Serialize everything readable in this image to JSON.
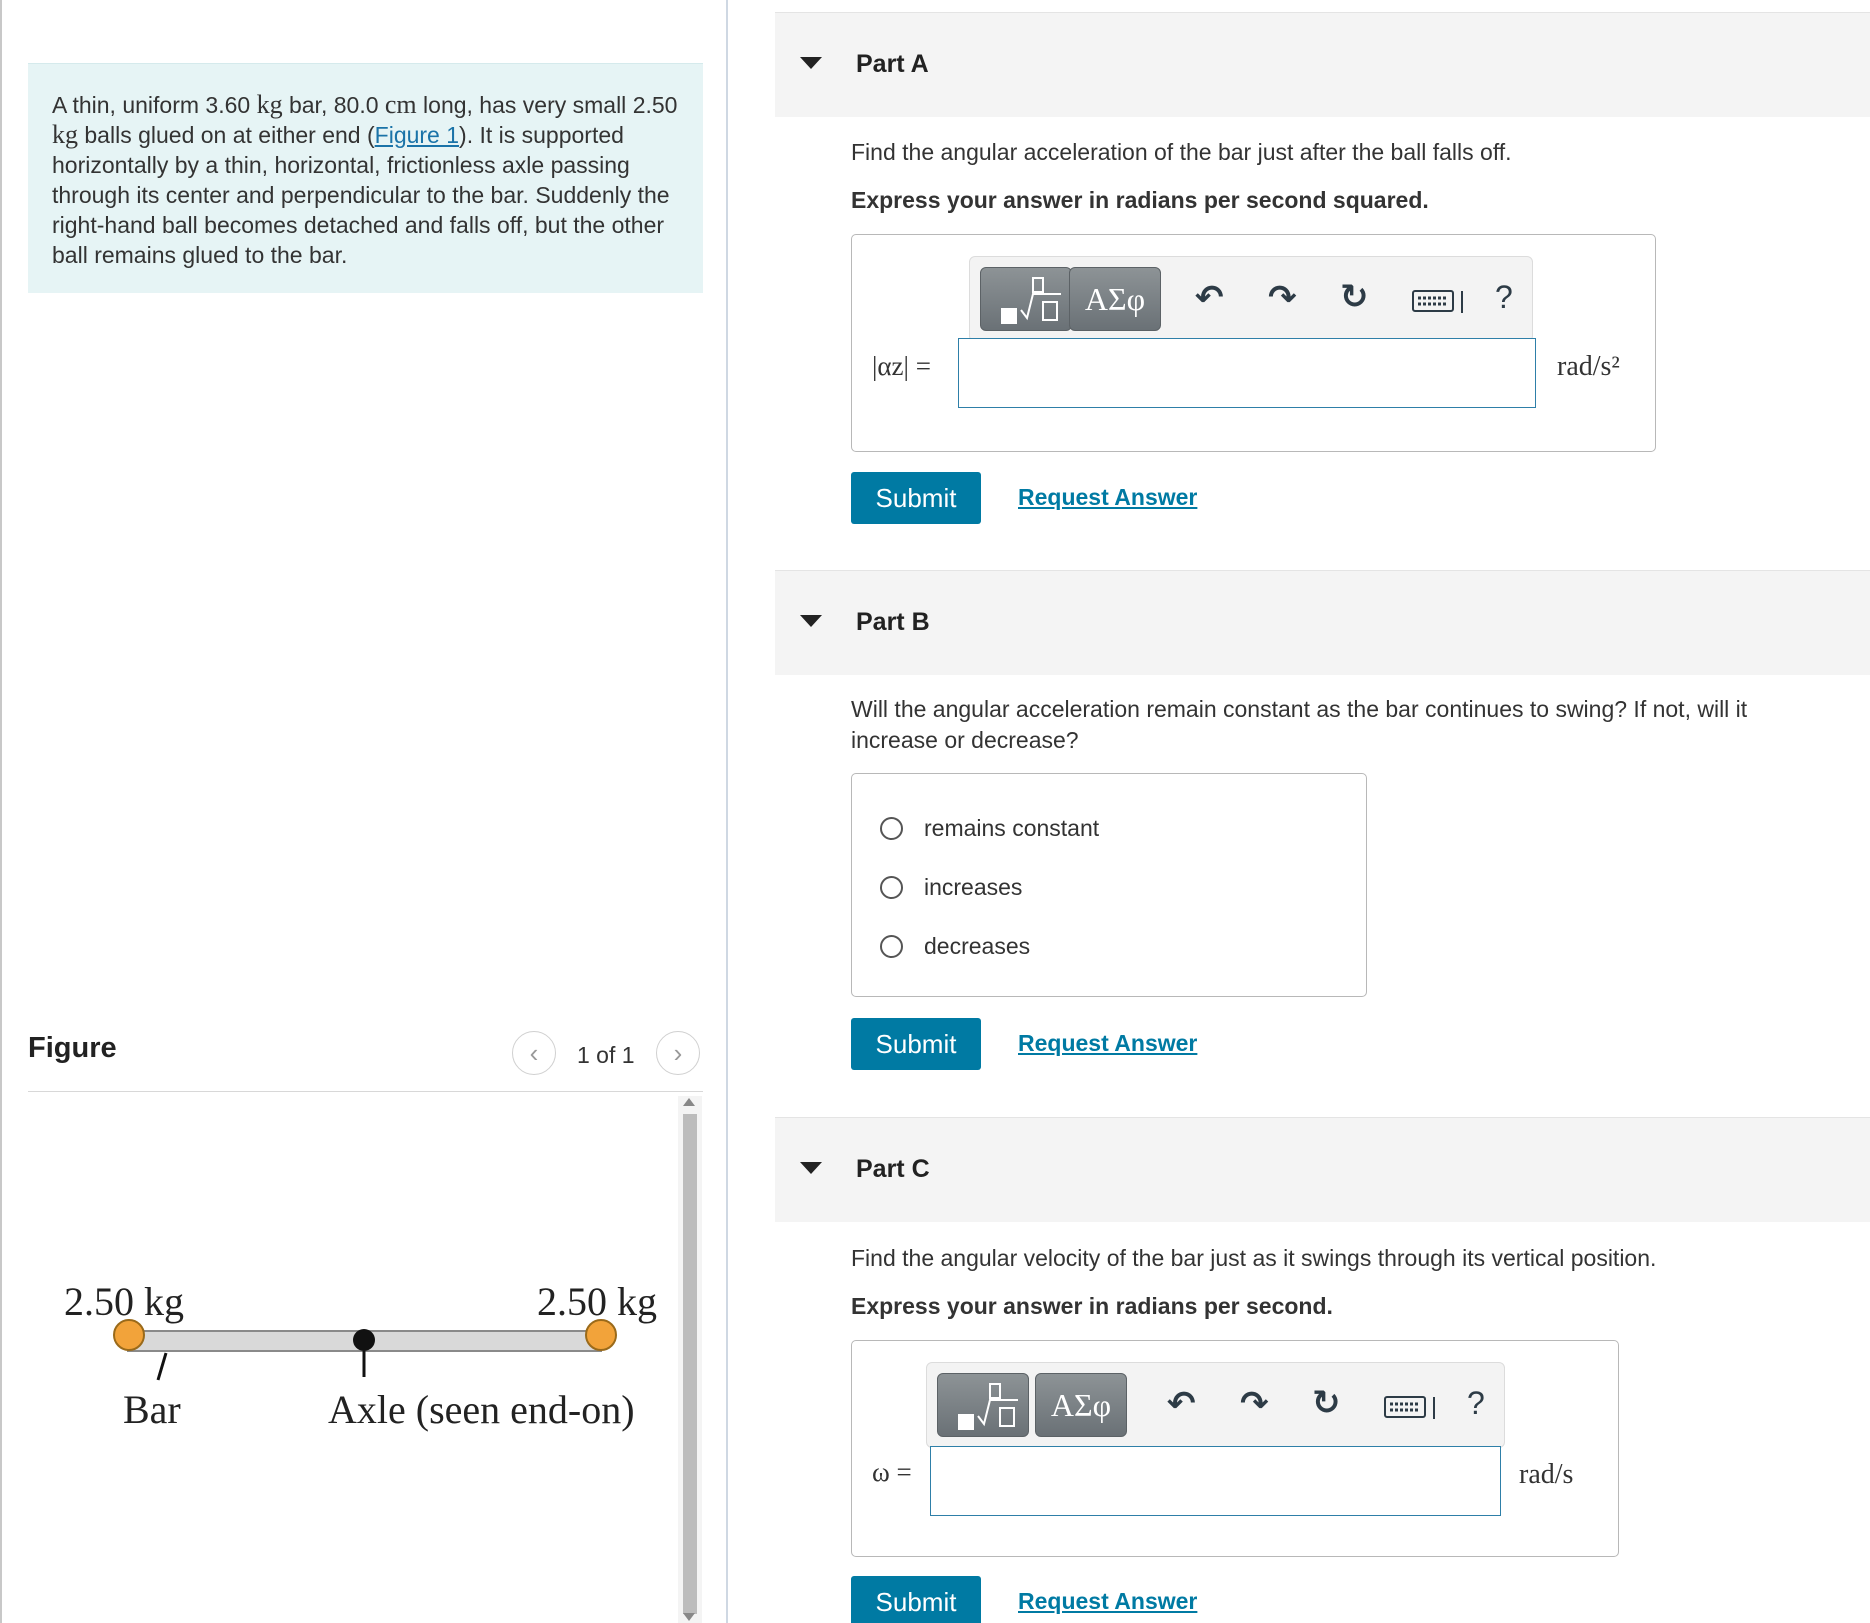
{
  "problem": {
    "text_1": "A thin, uniform ",
    "mass_bar": "3.60",
    "unit_kg": "kg",
    "text_2": " bar, ",
    "length": "80.0",
    "unit_cm": "cm",
    "text_3": " long, has very small ",
    "mass_ball": "2.50",
    "unit_kg_2": "kg",
    "text_4": " balls glued on at either end (",
    "figure_link": "Figure 1",
    "text_5": "). It is supported horizontally by a thin, horizontal, frictionless axle passing through its center and perpendicular to the bar. Suddenly the right-hand ball becomes detached and falls off, but the other ball remains glued to the bar."
  },
  "figure": {
    "title": "Figure",
    "pager_text": "1 of 1",
    "prev_icon": "chevron-left-icon",
    "next_icon": "chevron-right-icon",
    "left_mass_label": "2.50 kg",
    "right_mass_label": "2.50 kg",
    "bar_label": "Bar",
    "axle_label": "Axle (seen end-on)",
    "ball_color": "#f2a33a",
    "bar_color": "#d9d9d9"
  },
  "parts": [
    {
      "title": "Part A",
      "prompt": "Find the angular acceleration of the bar just after the ball falls off.",
      "instruction": "Express your answer in radians per second squared.",
      "math_label": "|αz| =",
      "unit": "rad/s²",
      "input_value": "",
      "submit": "Submit",
      "request": "Request Answer"
    },
    {
      "title": "Part B",
      "prompt": "Will the angular acceleration remain constant as the bar continues to swing? If not, will it increase or decrease?",
      "options": [
        "remains constant",
        "increases",
        "decreases"
      ],
      "submit": "Submit",
      "request": "Request Answer"
    },
    {
      "title": "Part C",
      "prompt": "Find the angular velocity of the bar just as it swings through its vertical position.",
      "instruction": "Express your answer in radians per second.",
      "math_label": "ω =",
      "unit": "rad/s",
      "input_value": "",
      "submit": "Submit",
      "request": "Request Answer"
    }
  ],
  "toolbar": {
    "templates_icon": "templates-icon",
    "greek_label": "ΑΣφ",
    "undo_icon": "undo-icon",
    "redo_icon": "redo-icon",
    "reset_icon": "reset-icon",
    "keyboard_icon": "keyboard-icon",
    "help_label": "?"
  },
  "colors": {
    "accent": "#007aa3",
    "problem_bg": "#e6f4f5",
    "part_header_bg": "#f4f4f4"
  }
}
